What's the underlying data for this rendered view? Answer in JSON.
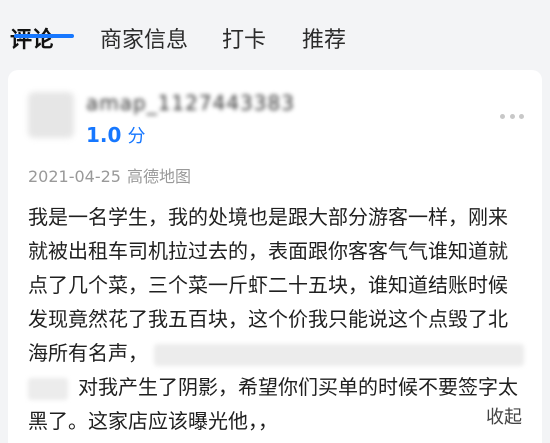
{
  "tabs": [
    {
      "label": "评论",
      "active": true
    },
    {
      "label": "商家信息",
      "active": false
    },
    {
      "label": "打卡",
      "active": false
    },
    {
      "label": "推荐",
      "active": false
    }
  ],
  "review": {
    "username": "amap_1127443383",
    "rating_value": "1.0",
    "rating_unit": "分",
    "date": "2021-04-25",
    "source": "高德地图",
    "lines": [
      "我是一名学生，我的处境也是跟大部分游客一样，刚来",
      "就被出租车司机拉过去的，表面跟你客客气气谁知道就",
      "点了几个菜，三个菜一斤虾二十五块，谁知道结账时候",
      "发现竟然花了我五百块，这个价我只能说这个点毁了北",
      "海所有名声，",
      "对我产生了阴影，希望你们买单的时候不要签字太",
      "黑了。这家店应该曝光他，，"
    ],
    "collapse_label": "收起"
  },
  "colors": {
    "accent": "#1677ff",
    "page_bg": "#f3f4f6",
    "card_bg": "#ffffff",
    "muted_text": "#999999"
  },
  "icons": {
    "more": "more-horizontal-icon"
  }
}
